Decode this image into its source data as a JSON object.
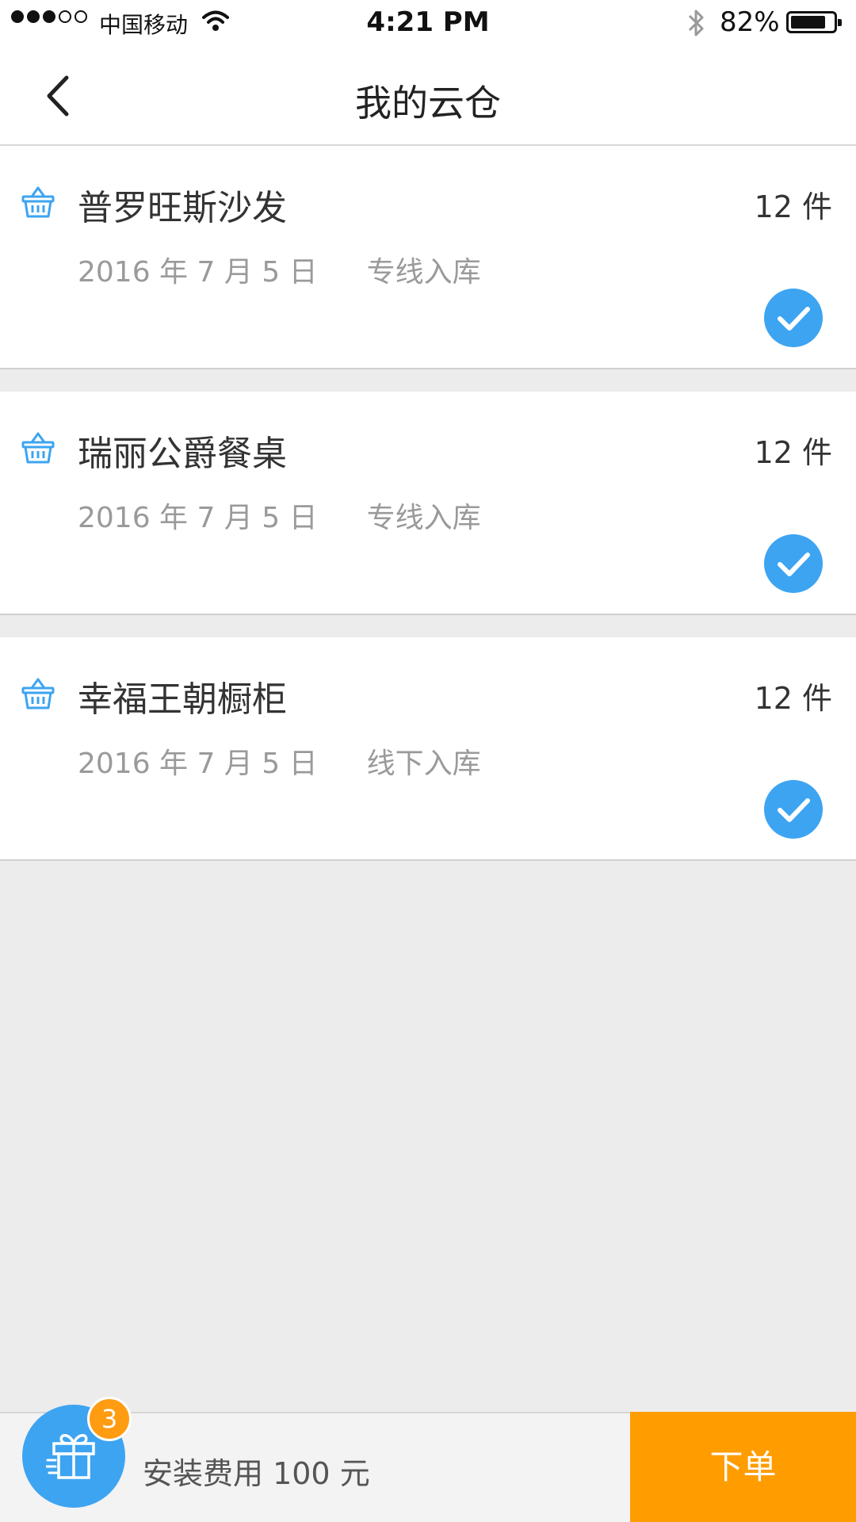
{
  "status_bar": {
    "carrier": "中国移动",
    "time": "4:21 PM",
    "battery_percent": "82%",
    "battery_level": 0.82,
    "signal_bars_filled": 3,
    "signal_bars_total": 5
  },
  "nav": {
    "title": "我的云仓",
    "back_icon": "chevron-left-icon"
  },
  "items": [
    {
      "name": "普罗旺斯沙发",
      "quantity": "12 件",
      "date": "2016 年 7 月 5 日",
      "method": "专线入库",
      "checked": true
    },
    {
      "name": "瑞丽公爵餐桌",
      "quantity": "12 件",
      "date": "2016 年 7 月 5 日",
      "method": "专线入库",
      "checked": true
    },
    {
      "name": "幸福王朝橱柜",
      "quantity": "12 件",
      "date": "2016 年 7 月 5 日",
      "method": "线下入库",
      "checked": true
    }
  ],
  "bottom_bar": {
    "gift_icon": "gift-icon",
    "badge_count": "3",
    "fee_text": "安装费用 100 元",
    "order_button_label": "下单"
  },
  "colors": {
    "accent_blue": "#3da4f1",
    "order_orange": "#ff9c00",
    "badge_orange": "#ff9c12",
    "background": "#ececec"
  }
}
